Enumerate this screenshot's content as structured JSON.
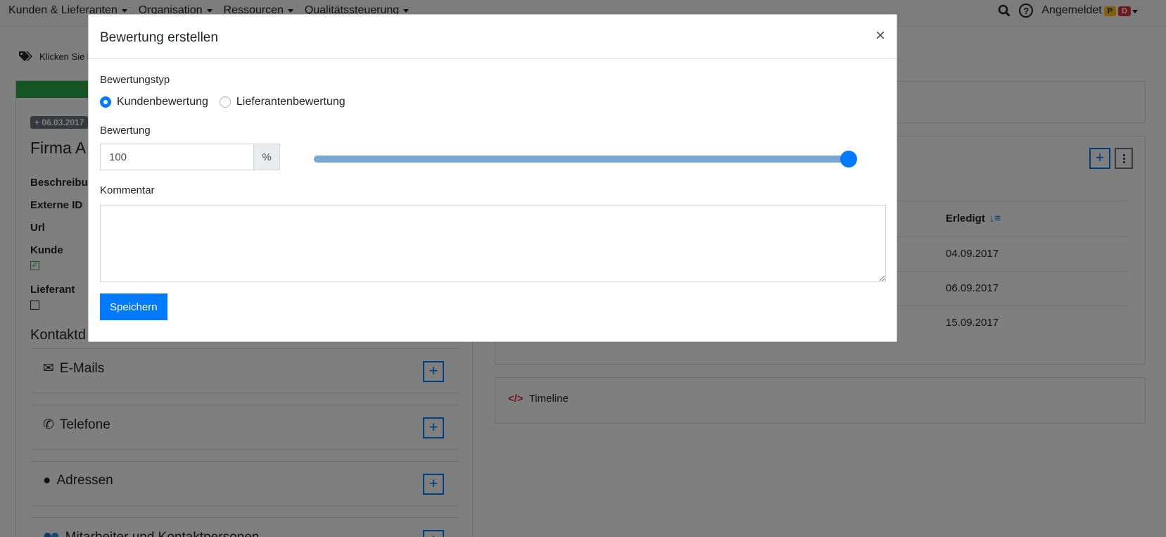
{
  "nav": {
    "menu": [
      "Kunden & Lieferanten",
      "Organisation",
      "Ressourcen",
      "Qualitätssteuerung"
    ],
    "logged_in": "Angemeldet",
    "badge_p": "P",
    "badge_d": "D"
  },
  "page": {
    "tag_hint": "Klicken Sie h",
    "date_badge": "06.03.2017",
    "firm_name": "Firma A",
    "fields": [
      "Beschreibu",
      "Externe ID",
      "Url",
      "Kunde",
      "Lieferant"
    ],
    "section_title": "Kontaktd",
    "accordions": [
      "E-Mails",
      "Telefone",
      "Adressen",
      "Mitarbeiter und Kontaktpersonen"
    ],
    "table_header": "Erledigt",
    "dates": [
      "04.09.2017",
      "06.09.2017",
      "15.09.2017"
    ],
    "timeline": "Timeline"
  },
  "modal": {
    "title": "Bewertung erstellen",
    "close": "×",
    "type_label": "Bewertungstyp",
    "radio_customer": "Kundenbewertung",
    "radio_supplier": "Lieferantenbewertung",
    "selected_type": "Kundenbewertung",
    "rating_label": "Bewertung",
    "rating_value": "100",
    "rating_unit": "%",
    "slider_percent": 100,
    "comment_label": "Kommentar",
    "comment_value": "",
    "save_label": "Speichern"
  },
  "colors": {
    "primary": "#007bff",
    "success": "#28a745",
    "danger": "#dc3545",
    "warning": "#ffc107"
  }
}
